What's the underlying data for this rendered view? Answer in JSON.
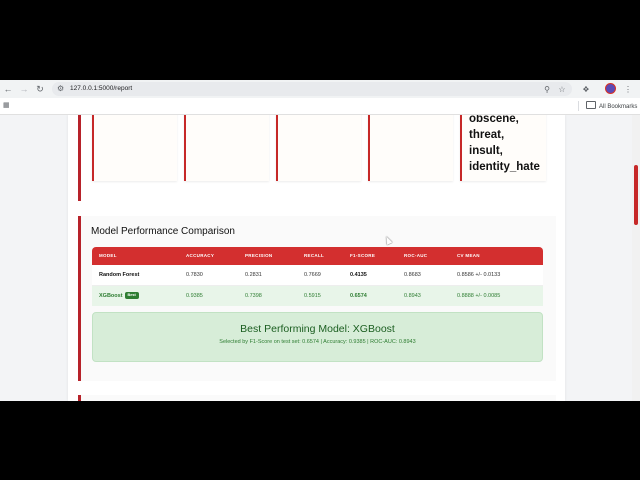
{
  "browser": {
    "url": "127.0.0.1:5000/report",
    "bookmarks_label": "All Bookmarks"
  },
  "icons": {
    "back": "arrow-left-icon",
    "forward": "arrow-right-icon",
    "reload": "reload-icon",
    "site_info": "site-info-icon",
    "zoom": "zoom-icon",
    "star": "star-icon",
    "extensions": "extensions-icon",
    "menu": "kebab-menu-icon",
    "apps": "apps-grid-icon",
    "folder": "folder-icon"
  },
  "labels_section": {
    "last_box_lines": [
      "obscene,",
      "threat,",
      "insult,",
      "identity_hate"
    ]
  },
  "performance": {
    "title": "Model Performance Comparison",
    "columns": [
      "MODEL",
      "ACCURACY",
      "PRECISION",
      "RECALL",
      "F1-SCORE",
      "ROC-AUC",
      "CV MEAN"
    ],
    "rows": [
      {
        "model": "Random Forest",
        "accuracy": "0.7830",
        "precision": "0.2831",
        "recall": "0.7669",
        "f1": "0.4135",
        "roc_auc": "0.8683",
        "cv_mean": "0.8586 +/- 0.0133"
      },
      {
        "model": "XGBoost",
        "badge": "Best",
        "accuracy": "0.9385",
        "precision": "0.7398",
        "recall": "0.5915",
        "f1": "0.6574",
        "roc_auc": "0.8943",
        "cv_mean": "0.8888 +/- 0.0085"
      }
    ],
    "best_title": "Best Performing Model: XGBoost",
    "best_subtitle": "Selected by F1-Score on test set: 0.6574 | Accuracy: 0.9385 | ROC-AUC: 0.8943"
  },
  "colors": {
    "accent_red": "#d32f2f",
    "best_green": "#2e7d32",
    "best_bg": "#d7edd8"
  }
}
